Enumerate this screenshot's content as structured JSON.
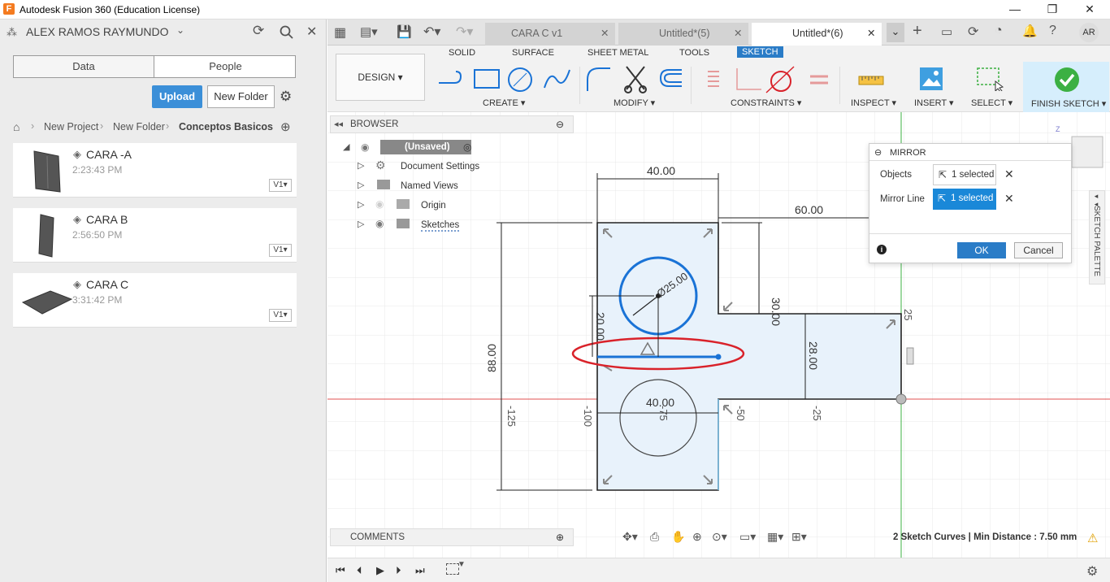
{
  "window": {
    "title": "Autodesk Fusion 360 (Education License)",
    "logo": "F"
  },
  "left": {
    "user": "ALEX RAMOS RAYMUNDO",
    "tabs": [
      "Data",
      "People"
    ],
    "upload": "Upload",
    "new_folder": "New Folder",
    "crumbs": [
      "New Project",
      "New Folder",
      "Conceptos Basicos"
    ],
    "files": [
      {
        "name": "CARA -A",
        "time": "2:23:43 PM",
        "ver": "V1"
      },
      {
        "name": "CARA B",
        "time": "2:56:50 PM",
        "ver": "V1"
      },
      {
        "name": "CARA C",
        "time": "3:31:42 PM",
        "ver": "V1"
      }
    ]
  },
  "tabs": [
    {
      "label": "CARA C v1"
    },
    {
      "label": "Untitled*(5)"
    },
    {
      "label": "Untitled*(6)"
    }
  ],
  "avatar": "AR",
  "toolbar": {
    "design": "DESIGN",
    "workspaces": [
      "SOLID",
      "SURFACE",
      "SHEET METAL",
      "TOOLS",
      "SKETCH"
    ],
    "groups": [
      "CREATE",
      "MODIFY",
      "CONSTRAINTS",
      "INSPECT",
      "INSERT",
      "SELECT",
      "FINISH SKETCH"
    ]
  },
  "browser": {
    "title": "BROWSER",
    "items": [
      "(Unsaved)",
      "Document Settings",
      "Named Views",
      "Origin",
      "Sketches"
    ]
  },
  "comments": "COMMENTS",
  "mirror": {
    "title": "MIRROR",
    "objects_label": "Objects",
    "objects_value": "1 selected",
    "line_label": "Mirror Line",
    "line_value": "1 selected",
    "ok": "OK",
    "cancel": "Cancel"
  },
  "palette": "SKETCH PALETTE",
  "status": "2 Sketch Curves | Min Distance : 7.50 mm",
  "dims": {
    "d40": "40.00",
    "d60": "60.00",
    "dia": "Ø25.00",
    "d30": "30.00",
    "d20": "20.00",
    "d28": "28.00",
    "d88": "88.00",
    "d40b": "40.00",
    "n125": "-125",
    "n100": "-100",
    "n75": "-75",
    "n50": "-50",
    "n25": "-25",
    "p25": "25"
  },
  "colors": {
    "accent": "#2a7cc7",
    "sketch_blue": "#1a73d6",
    "highlight": "#d9222a",
    "axis_red": "#e05050",
    "axis_green": "#3cb043",
    "fill": "#e8f2fb"
  }
}
